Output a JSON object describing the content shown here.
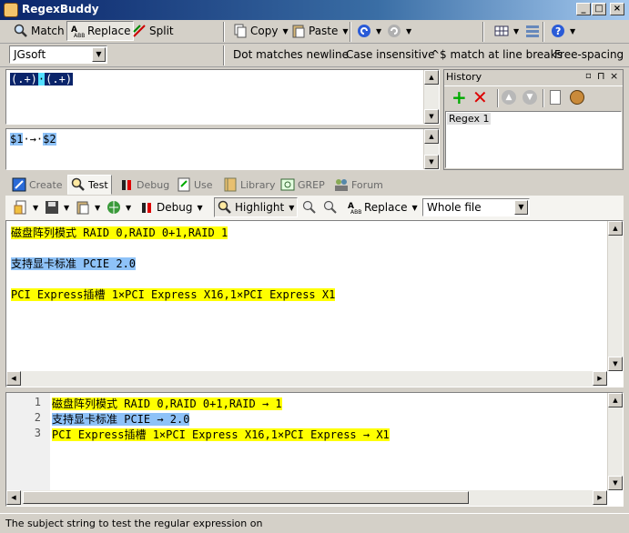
{
  "window": {
    "title": "RegexBuddy"
  },
  "toolbar1": {
    "match_label": "Match",
    "replace_label": "Replace",
    "split_label": "Split",
    "copy_label": "Copy",
    "paste_label": "Paste"
  },
  "toolbar2": {
    "flavor_value": "JGsoft",
    "options": [
      "Dot matches newline",
      "Case insensitive",
      "^$ match at line breaks",
      "Free-spacing"
    ]
  },
  "regex": {
    "part1": "(.+)",
    "part2": "·",
    "part3": "(.+)"
  },
  "replacement": {
    "part1": "$1",
    "part2": "·→·",
    "part3": "$2"
  },
  "history": {
    "title": "History",
    "items": [
      "Regex 1"
    ]
  },
  "tabs": [
    "Create",
    "Test",
    "Debug",
    "Use",
    "Library",
    "GREP",
    "Forum"
  ],
  "test_toolbar": {
    "debug_label": "Debug",
    "highlight_label": "Highlight",
    "replace_label": "Replace",
    "scope_value": "Whole file"
  },
  "subject_lines": [
    "磁盘阵列模式 RAID 0,RAID 0+1,RAID 1",
    "支持显卡标准 PCIE 2.0",
    "PCI Express插槽 1×PCI Express X16,1×PCI Express X1"
  ],
  "result_lines": [
    {
      "num": "1",
      "text": "磁盘阵列模式 RAID 0,RAID 0+1,RAID → 1"
    },
    {
      "num": "2",
      "text": "支持显卡标准 PCIE → 2.0"
    },
    {
      "num": "3",
      "text": "PCI Express插槽 1×PCI Express X16,1×PCI Express → X1"
    }
  ],
  "status": {
    "text": "The subject string to test the regular expression on"
  },
  "colors": {
    "match_yellow": "#ffff00",
    "match_blue": "#8ec2f8",
    "title_bar": "#0a246a"
  }
}
